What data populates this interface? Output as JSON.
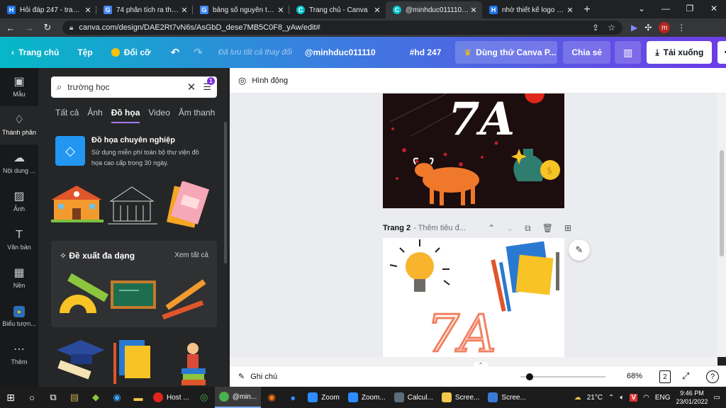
{
  "browser": {
    "tabs": [
      {
        "title": "Hỏi đáp 247 - trang tr",
        "fav": "H",
        "color": "#1a73e8"
      },
      {
        "title": "74 phân tích ra thừa s",
        "fav": "G",
        "color": "#4285f4"
      },
      {
        "title": "bảng số nguyên tố nh",
        "fav": "G",
        "color": "#4285f4"
      },
      {
        "title": "Trang chủ - Canva",
        "fav": "C",
        "color": "#00c4cc"
      },
      {
        "title": "@minhduc011110 #h",
        "fav": "C",
        "color": "#00c4cc"
      },
      {
        "title": "nhờ thiết kế logo có c",
        "fav": "H",
        "color": "#1a73e8"
      }
    ],
    "url": "canva.com/design/DAE2Rt7vN6s/AsGbD_dese7MB5C0F8_yAw/edit#",
    "profile_initial": "m"
  },
  "header": {
    "home": "Trang chủ",
    "file": "Tệp",
    "change": "Đổi cỡ",
    "saved": "Đã lưu tất cả thay đổi",
    "username": "@minhduc011110",
    "hashtag": "#hd 247",
    "trial": "Dùng thử Canva P...",
    "share": "Chia sẻ",
    "download": "Tải xuống"
  },
  "rail": [
    {
      "label": "Mẫu",
      "icon": "template-icon"
    },
    {
      "label": "Thành phần",
      "icon": "elements-icon"
    },
    {
      "label": "Nội dung ...",
      "icon": "upload-icon"
    },
    {
      "label": "Ảnh",
      "icon": "photo-icon"
    },
    {
      "label": "Văn bản",
      "icon": "text-icon"
    },
    {
      "label": "Nền",
      "icon": "background-icon"
    },
    {
      "label": "Biểu tượn...",
      "icon": "logo-icon"
    },
    {
      "label": "Thêm",
      "icon": "more-icon"
    }
  ],
  "panel": {
    "search_value": "trường học",
    "filter_badge": "1",
    "tabs": [
      "Tất cả",
      "Ảnh",
      "Đồ họa",
      "Video",
      "Âm thanh"
    ],
    "active_tab": "Đồ họa",
    "promo_title": "Đồ họa chuyên nghiệp",
    "promo_desc_1": "Sử dụng miễn phí toàn bộ thư viện đồ",
    "promo_desc_2": "họa cao cấp trong 30 ngày.",
    "suggest_title": "Đề xuất đa dạng",
    "suggest_all": "Xem tất cả"
  },
  "toolbar": {
    "animate": "Hình động"
  },
  "canvas": {
    "page1_text": "7A",
    "page2_label": "Trang 2",
    "page2_title": "- Thêm tiêu đ...",
    "page2_text": "7A"
  },
  "footer": {
    "notes": "Ghi chú",
    "zoom": "68%",
    "pages": "2"
  },
  "taskbar": {
    "apps": [
      "Host ...",
      "@min...",
      "Zoom",
      "Zoom...",
      "Calcul...",
      "Scree...",
      "Scree..."
    ],
    "weather": "21°C",
    "lang": "ENG",
    "time": "9:46 PM",
    "date": "23/01/2022"
  },
  "colors": {
    "accent": "#7d2ae8",
    "header_start": "#05b8c7",
    "header_end": "#6e3ce6"
  }
}
